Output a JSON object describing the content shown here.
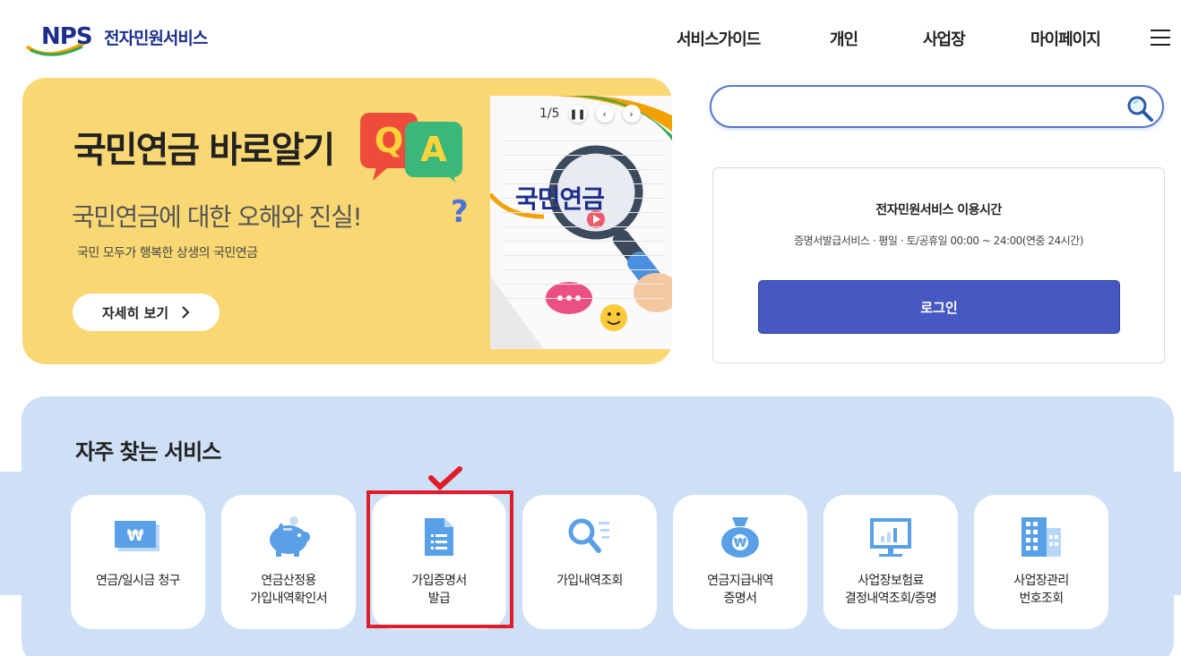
{
  "header": {
    "logo_text": "NPS",
    "service_name": "전자민원서비스",
    "nav": [
      "서비스가이드",
      "개인",
      "사업장",
      "마이페이지"
    ]
  },
  "banner": {
    "title": "국민연금 바로알기",
    "subtitle": "국민연금에 대한 오해와 진실!",
    "description": "국민 모두가 행복한 상생의 국민연금",
    "more_label": "자세히 보기",
    "more_icon": "chevron-right-icon",
    "pager": "1/5",
    "paper_text": "국민연금"
  },
  "search": {
    "placeholder": "",
    "value": ""
  },
  "service_hours": {
    "title": "전자민원서비스 이용시간",
    "description": "증명서발급서비스 · 평일 · 토/공휴일 00:00 ~ 24:00(연중 24시간)",
    "login_label": "로그인"
  },
  "favorites": {
    "title": "자주 찾는 서비스",
    "items": [
      {
        "icon": "money-bill-icon",
        "lines": [
          "연금/일시금 청구"
        ]
      },
      {
        "icon": "piggy-bank-icon",
        "lines": [
          "연금산정용",
          "가입내역확인서"
        ]
      },
      {
        "icon": "document-icon",
        "lines": [
          "가입증명서",
          "발급"
        ]
      },
      {
        "icon": "search-list-icon",
        "lines": [
          "가입내역조회"
        ]
      },
      {
        "icon": "money-bag-icon",
        "lines": [
          "연금지급내역",
          "증명서"
        ]
      },
      {
        "icon": "monitor-chart-icon",
        "lines": [
          "사업장보험료",
          "결정내역조회/증명"
        ]
      },
      {
        "icon": "building-icon",
        "lines": [
          "사업장관리",
          "번호조회"
        ]
      }
    ]
  },
  "colors": {
    "brand": "#1d2f8a",
    "banner_bg": "#f9d873",
    "login_bg": "#4658c2",
    "fav_bg": "#cde0f6",
    "highlight": "#e01c2b",
    "icon_blue": "#5aa0e6"
  }
}
